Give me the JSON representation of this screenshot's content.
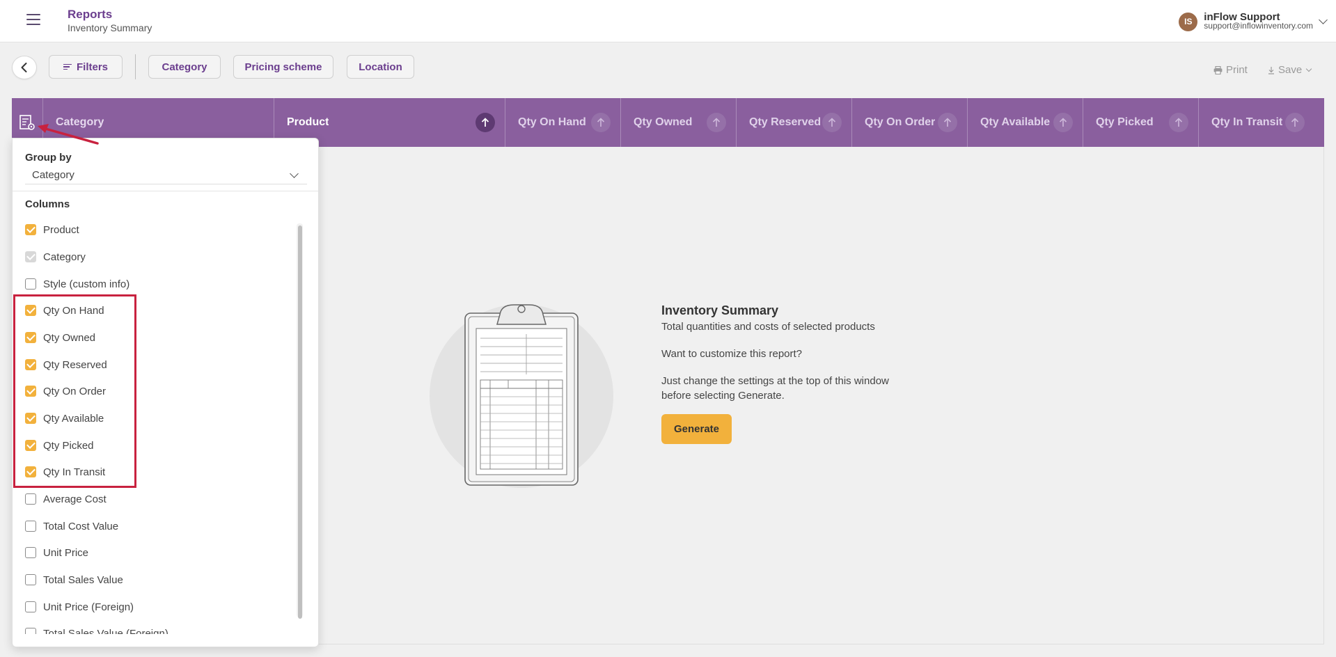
{
  "header": {
    "title": "Reports",
    "subtitle": "Inventory Summary",
    "user": {
      "initials": "IS",
      "name": "inFlow Support",
      "email": "support@inflowinventory.com"
    }
  },
  "toolbar": {
    "filters_label": "Filters",
    "chips": [
      "Category",
      "Pricing scheme",
      "Location"
    ],
    "print_label": "Print",
    "save_label": "Save"
  },
  "table": {
    "columns": [
      {
        "label": "Category",
        "sortable": false
      },
      {
        "label": "Product",
        "sortable": true,
        "active": true
      },
      {
        "label": "Qty On Hand",
        "sortable": true
      },
      {
        "label": "Qty Owned",
        "sortable": true
      },
      {
        "label": "Qty Reserved",
        "sortable": true
      },
      {
        "label": "Qty On Order",
        "sortable": true
      },
      {
        "label": "Qty Available",
        "sortable": true
      },
      {
        "label": "Qty Picked",
        "sortable": true
      },
      {
        "label": "Qty In Transit",
        "sortable": true
      }
    ]
  },
  "empty_state": {
    "title": "Inventory Summary",
    "description": "Total quantities and costs of selected products",
    "prompt": "Want to customize this report?",
    "instructions": "Just change the settings at the top of this window before selecting Generate.",
    "generate_label": "Generate"
  },
  "column_panel": {
    "group_by_label": "Group by",
    "group_by_value": "Category",
    "columns_label": "Columns",
    "items": [
      {
        "label": "Product",
        "state": "checked"
      },
      {
        "label": "Category",
        "state": "disabled"
      },
      {
        "label": "Style (custom info)",
        "state": "unchecked"
      },
      {
        "label": "Qty On Hand",
        "state": "checked"
      },
      {
        "label": "Qty Owned",
        "state": "checked"
      },
      {
        "label": "Qty Reserved",
        "state": "checked"
      },
      {
        "label": "Qty On Order",
        "state": "checked"
      },
      {
        "label": "Qty Available",
        "state": "checked"
      },
      {
        "label": "Qty Picked",
        "state": "checked"
      },
      {
        "label": "Qty In Transit",
        "state": "checked"
      },
      {
        "label": "Average Cost",
        "state": "unchecked"
      },
      {
        "label": "Total Cost Value",
        "state": "unchecked"
      },
      {
        "label": "Unit Price",
        "state": "unchecked"
      },
      {
        "label": "Total Sales Value",
        "state": "unchecked"
      },
      {
        "label": "Unit Price (Foreign)",
        "state": "unchecked"
      },
      {
        "label": "Total Sales Value (Foreign)",
        "state": "unchecked"
      }
    ]
  },
  "colors": {
    "brand_purple": "#6b3e8e",
    "header_purple": "#8a5f9e",
    "accent_orange": "#f2b13c",
    "annotation_red": "#c8223f"
  }
}
